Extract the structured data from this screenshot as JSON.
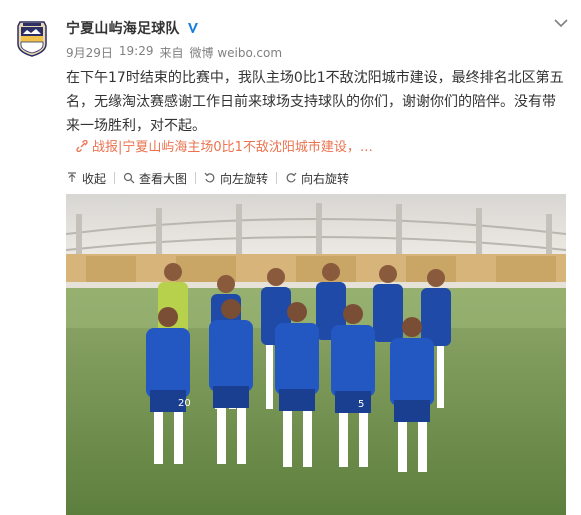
{
  "account": {
    "name": "宁夏山屿海足球队",
    "verified_badge": "V"
  },
  "meta": {
    "date": "9月29日",
    "time": "19:29",
    "source_prefix": "来自",
    "source": "微博 weibo.com"
  },
  "post": {
    "text": "在下午17时结束的比赛中，我队主场0比1不敌沈阳城市建设，最终排名北区第五名，无缘淘汰赛感谢工作日前来球场支持球队的你们，谢谢你们的陪伴。没有带来一场胜利，对不起。"
  },
  "link": {
    "label": "战报|宁夏山屿海主场0比1不敌沈阳城市建设，…"
  },
  "toolbar": {
    "collapse": "收起",
    "view_large": "查看大图",
    "rotate_left": "向左旋转",
    "rotate_right": "向右旋转"
  },
  "photo": {
    "jersey_numbers": [
      "20",
      "5"
    ]
  },
  "colors": {
    "accent": "#eb7350",
    "text": "#333333",
    "muted": "#808080",
    "verified": "#1b7fe0"
  },
  "icons": [
    "team-logo-avatar",
    "verified-icon",
    "chevron-down-icon",
    "link-icon",
    "collapse-icon",
    "search-icon",
    "rotate-left-icon",
    "rotate-right-icon"
  ]
}
